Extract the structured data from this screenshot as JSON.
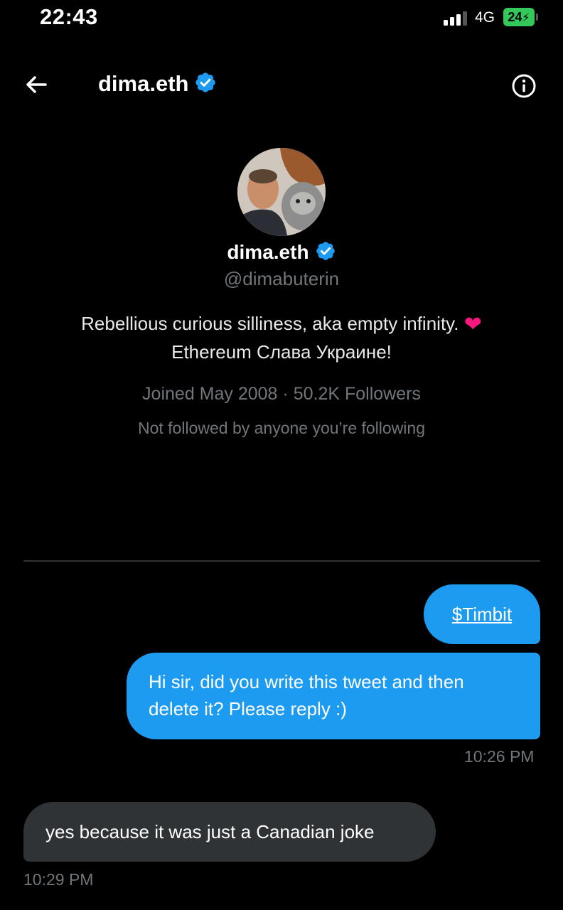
{
  "status_bar": {
    "time": "22:43",
    "network": "4G",
    "battery": "24",
    "battery_color": "#34c759"
  },
  "header": {
    "name": "dima.eth",
    "back_icon": "arrow-left-icon",
    "info_icon": "info-circle-icon",
    "verified_icon": "verified-badge-icon"
  },
  "profile": {
    "name": "dima.eth",
    "handle": "@dimabuterin",
    "bio_line1": "Rebellious curious silliness, aka empty infinity.",
    "bio_emoji": "❤️",
    "bio_line2": "Ethereum Слава Украине!",
    "joined": "Joined May 2008",
    "separator": "·",
    "followers": "50.2K Followers",
    "mutuals": "Not followed by anyone you’re following"
  },
  "messages": [
    {
      "direction": "outgoing",
      "text": "$Timbit",
      "is_link": true
    },
    {
      "direction": "outgoing",
      "text": "Hi sir, did you write this tweet and then delete it? Please reply :)",
      "timestamp": "10:26 PM"
    },
    {
      "direction": "incoming",
      "text": "yes because it was just a Canadian joke",
      "timestamp": "10:29 PM"
    }
  ],
  "colors": {
    "background": "#000000",
    "accent_blue": "#1d9bf0",
    "incoming_bubble": "#2f3336",
    "secondary_text": "#71767b",
    "heart": "#f91880"
  }
}
